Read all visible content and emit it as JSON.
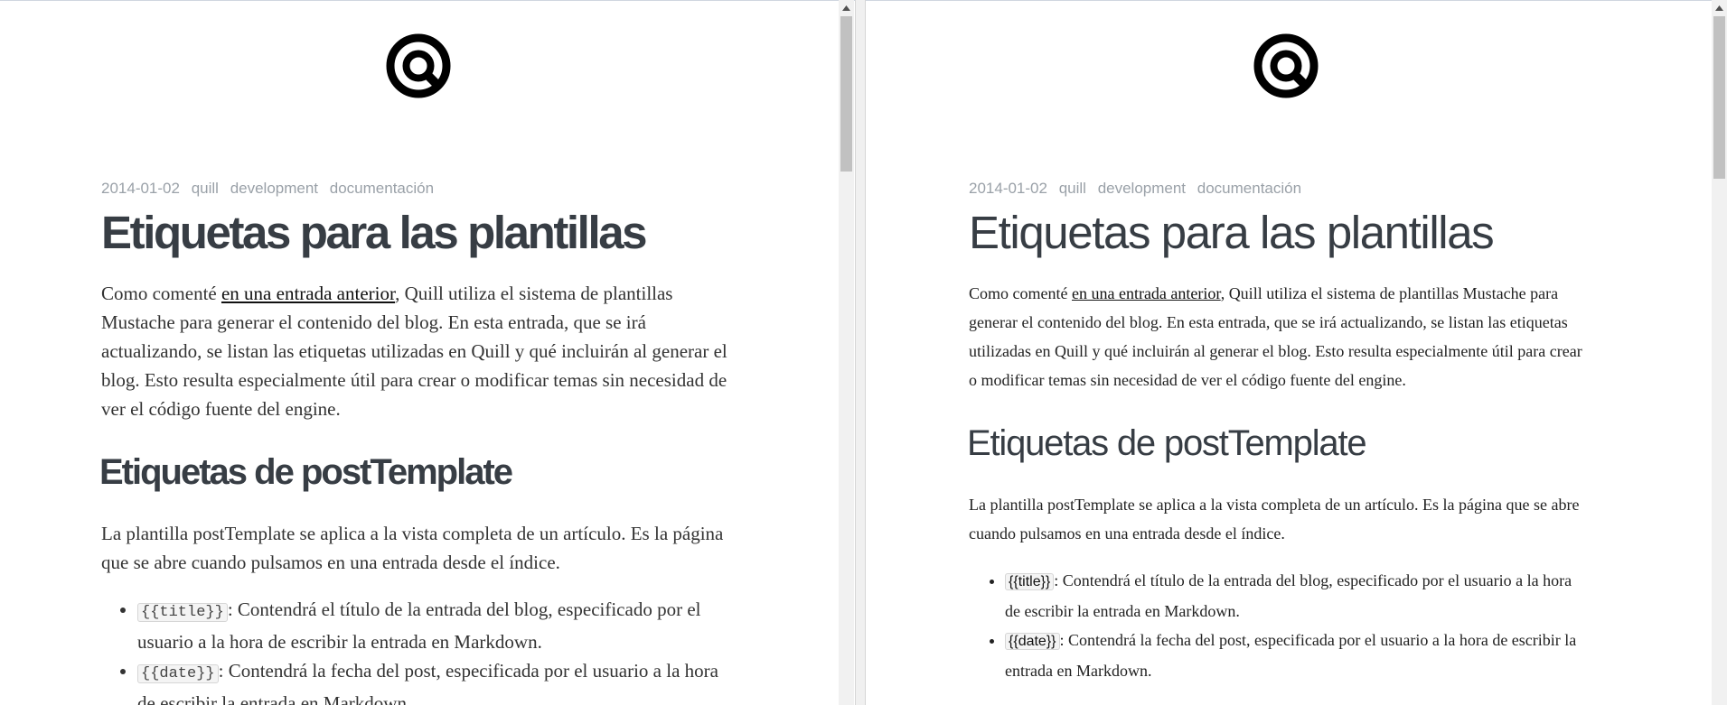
{
  "post": {
    "date": "2014-01-02",
    "tags": [
      "quill",
      "development",
      "documentación"
    ],
    "title": "Etiquetas para las plantillas",
    "intro": {
      "before_link": "Como comenté ",
      "link_text": "en una entrada anterior",
      "after_link": ", Quill utiliza el sistema de plantillas Mustache para generar el contenido del blog. En esta entrada, que se irá actualizando, se listan las etiquetas utilizadas en Quill y qué incluirán al generar el blog. Esto resulta especialmente útil para crear o modificar temas sin necesidad de ver el código fuente del engine."
    },
    "section_title": "Etiquetas de postTemplate",
    "section_text": "La plantilla postTemplate se aplica a la vista completa de un artículo. Es la página que se abre cuando pulsamos en una entrada desde el índice.",
    "items": [
      {
        "tag": "{{title}}",
        "text": ": Contendrá el título de la entrada del blog, especificado por el usuario a la hora de escribir la entrada en Markdown."
      },
      {
        "tag": "{{date}}",
        "text": ": Contendrá la fecha del post, especificada por el usuario a la hora de escribir la entrada en Markdown."
      }
    ]
  },
  "icons": {
    "logo": "quill-logo-icon",
    "scroll_up": "scroll-up-arrow-icon"
  },
  "colors": {
    "text_heading": "#373d44",
    "text_meta": "#9aa1a8",
    "code_bg": "#f4f4f4"
  }
}
